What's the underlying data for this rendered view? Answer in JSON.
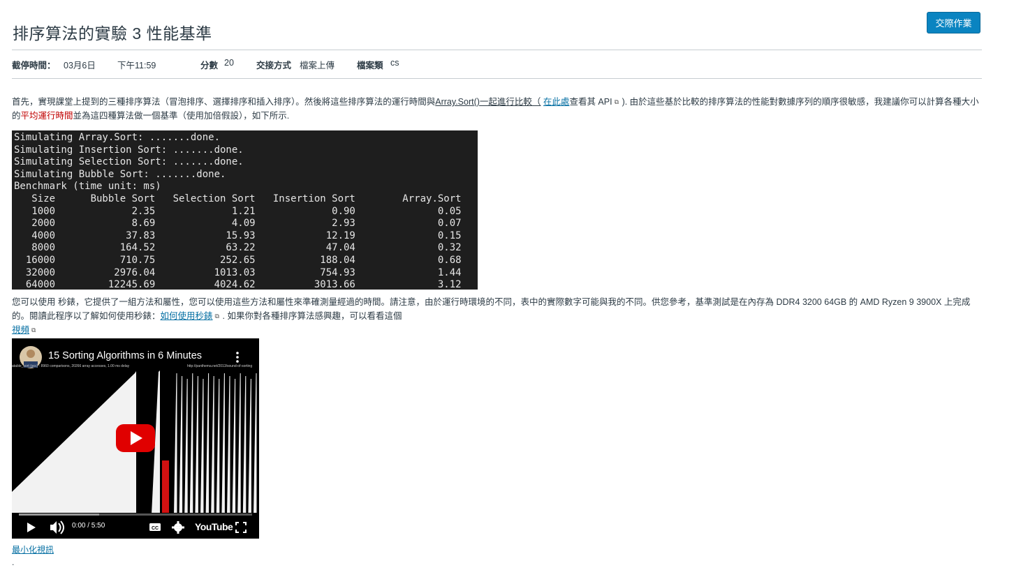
{
  "header": {
    "title": "排序算法的實驗 3 性能基準",
    "submit_label": "交際作業"
  },
  "meta": {
    "due_label": "截停時間：",
    "due_date": "03月6日",
    "due_time": "下午11:59",
    "points_label": "分數",
    "points_value": "20",
    "submission_label": "交接方式",
    "submission_value": "檔案上傳",
    "filetype_label": "檔案類",
    "filetype_value": "cs"
  },
  "intro": {
    "part1": "首先，實現課堂上提到的三種排序算法（冒泡排序、選擇排序和插入排序）。然後將這些排序算法的運行時間與",
    "array_sort_link": "Array.Sort()一起進行比較（",
    "here_link": "在此處",
    "part2": "查看其 API",
    "part3": "). 由於這些基於比較的排序算法的性能對數據序列的順序很敏感，我建議你可以計算各種大小的",
    "highlight": "平均運行時間",
    "part4": "並為這四種算法做一個基準（使用加倍假設），如下所示."
  },
  "terminal": {
    "lines": [
      "Simulating Array.Sort: .......done.",
      "Simulating Insertion Sort: .......done.",
      "Simulating Selection Sort: .......done.",
      "Simulating Bubble Sort: .......done.",
      "Benchmark (time unit: ms)",
      "   Size      Bubble Sort   Selection Sort   Insertion Sort        Array.Sort",
      "   1000             2.35             1.21             0.90              0.05",
      "   2000             8.69             4.09             2.93              0.07",
      "   4000            37.83            15.93            12.19              0.15",
      "   8000           164.52            63.22            47.04              0.32",
      "  16000           710.75           252.65           188.04              0.68",
      "  32000          2976.04          1013.03           754.93              1.44",
      "  64000         12245.69          4024.62          3013.66              3.12"
    ]
  },
  "stopwatch": {
    "part1": "您可以使用 秒錶，它提供了一組方法和屬性，您可以使用這些方法和屬性來準確測量經過的時間。請注意，由於運行時環境的不同，表中的實際數字可能與我的不同。供您參考，基準測試是在內存為 DDR4 3200 64GB 的 AMD Ryzen 9 3900X 上完成的。閱讀此程序以了解如何使用秒錶：",
    "howto_link": "如何使用秒錶",
    "part2": ". 如果你對各種排序算法感興趣，可以看看這個",
    "video_link": "視頻"
  },
  "video": {
    "title": "15 Sorting Algorithms in 6 Minutes",
    "caption_left": "atable_sort (gcc) - 8960 comparisons, 20266 array accesses, 1.00 ms delay",
    "caption_right": "http://panthema.net/2013/sound-of-sorting",
    "time": "0:00 / 5:50",
    "youtube_label": "YouTube",
    "progress": 0.0
  },
  "footer": {
    "minimize_link": "最小化視訊",
    "trailing": "."
  }
}
